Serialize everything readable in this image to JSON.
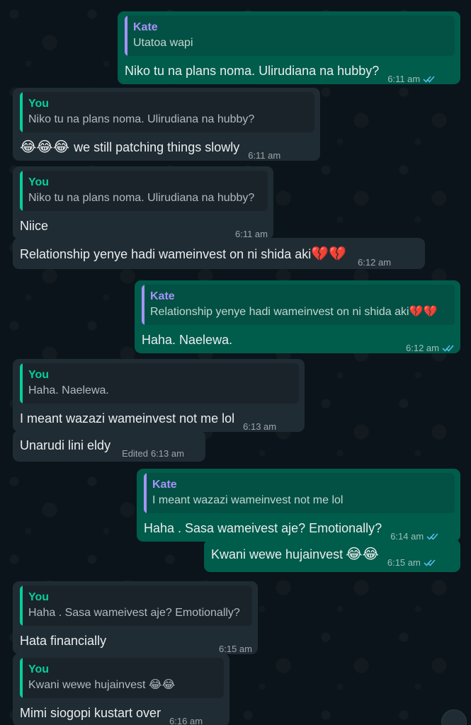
{
  "messages": [
    {
      "dir": "out",
      "quote_author": "Kate",
      "quote_text": "Utatoa wapi",
      "text": "Niko tu na plans noma. Ulirudiana na hubby?",
      "time": "6:11 am"
    },
    {
      "dir": "in",
      "quote_author": "You",
      "quote_text": "Niko tu na plans noma. Ulirudiana na hubby?",
      "emoji": "😂😂😂",
      "text": "we still patching things slowly",
      "time": "6:11 am"
    },
    {
      "dir": "in",
      "quote_author": "You",
      "quote_text": "Niko tu na plans noma. Ulirudiana na hubby?",
      "text": "Niice",
      "time": "6:11 am"
    },
    {
      "dir": "in",
      "text": "Relationship yenye hadi wameinvest on ni shida aki",
      "emoji_after": "💔💔",
      "time": "6:12 am"
    },
    {
      "dir": "out",
      "quote_author": "Kate",
      "quote_text": "Relationship yenye hadi wameinvest on ni shida aki",
      "quote_emoji": "💔💔",
      "text": "Haha. Naelewa.",
      "time": "6:12 am"
    },
    {
      "dir": "in",
      "quote_author": "You",
      "quote_text": "Haha. Naelewa.",
      "text": "I meant wazazi wameinvest not me lol",
      "time": "6:13 am"
    },
    {
      "dir": "in",
      "text": "Unarudi lini eldy",
      "edited": "Edited",
      "time": "6:13 am"
    },
    {
      "dir": "out",
      "quote_author": "Kate",
      "quote_text": "I meant wazazi wameinvest not me lol",
      "text": "Haha . Sasa wameivest aje? Emotionally?",
      "time": "6:14 am"
    },
    {
      "dir": "out",
      "text": "Kwani wewe hujainvest",
      "emoji_after": "😂😂",
      "time": "6:15 am"
    },
    {
      "dir": "in",
      "quote_author": "You",
      "quote_text": "Haha . Sasa wameivest aje? Emotionally?",
      "text": "Hata financially",
      "time": "6:15 am"
    },
    {
      "dir": "in",
      "quote_author": "You",
      "quote_text": "Kwani wewe hujainvest",
      "quote_emoji": "😂😂",
      "text": "Mimi siogopi kustart over",
      "time": "6:16 am"
    }
  ],
  "colors": {
    "bg": "#0b141a",
    "incoming_bubble": "#202c33",
    "outgoing_bubble": "#005c4b",
    "you_accent": "#06cf9c",
    "kate_accent": "#a892fa",
    "read_ticks": "#53bdeb"
  },
  "icons": {
    "read_receipt": "double-check-icon",
    "scroll_down": "chevron-down-icon"
  }
}
